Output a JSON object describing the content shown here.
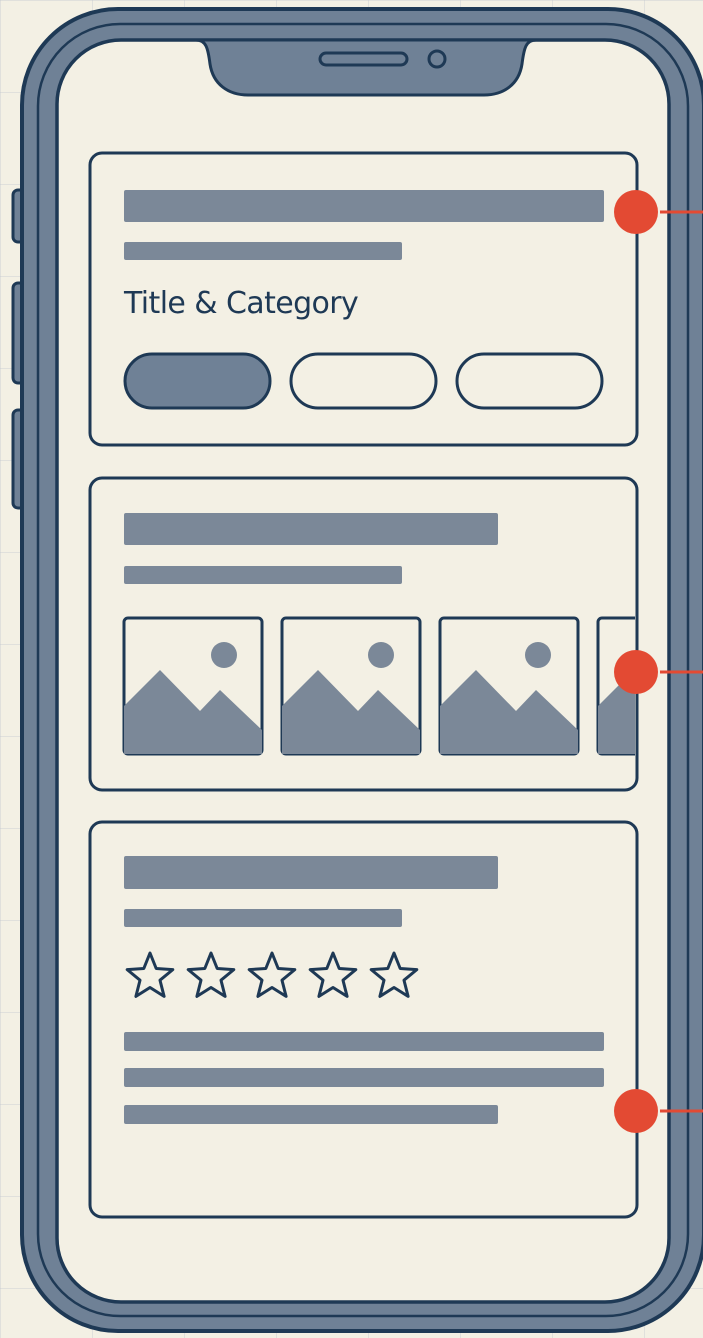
{
  "cards": {
    "title_category": {
      "heading": "Title & Category",
      "pills": [
        {
          "state": "selected"
        },
        {
          "state": "unselected"
        },
        {
          "state": "unselected"
        }
      ]
    },
    "gallery": {
      "thumbnails": 4
    },
    "reviews": {
      "rating": {
        "max": 5,
        "filled": 0
      }
    }
  },
  "colors": {
    "background": "#f3f0e4",
    "outline": "#1e3955",
    "frame": "#6f8196",
    "placeholder": "#7b8898",
    "accent": "#e34a33"
  }
}
